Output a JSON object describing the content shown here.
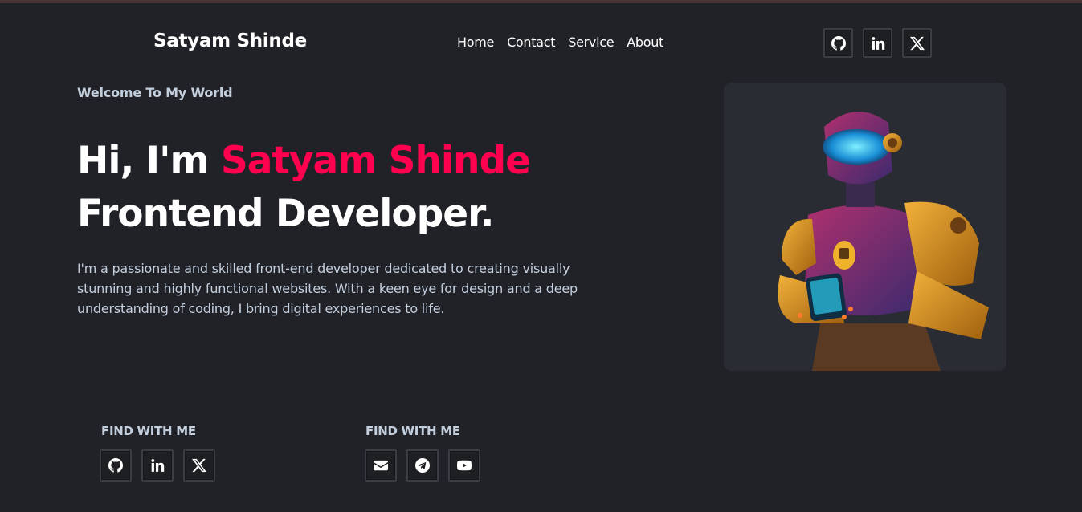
{
  "header": {
    "brand": "Satyam Shinde",
    "nav": [
      "Home",
      "Contact",
      "Service",
      "About"
    ]
  },
  "hero": {
    "welcome": "Welcome To My World",
    "greeting": "Hi, I'm ",
    "name": "Satyam Shinde",
    "role": "Frontend Developer.",
    "description": "I'm a passionate and skilled front-end developer dedicated to creating visually stunning and highly functional websites. With a keen eye for design and a deep understanding of coding, I bring digital experiences to life."
  },
  "social_left": {
    "heading": "FIND WITH ME",
    "icons": [
      "github-icon",
      "linkedin-icon",
      "x-icon"
    ]
  },
  "social_right": {
    "heading": "FIND WITH ME",
    "icons": [
      "email-icon",
      "telegram-icon",
      "youtube-icon"
    ]
  },
  "top_social": {
    "icons": [
      "github-icon",
      "linkedin-icon",
      "x-icon"
    ]
  },
  "colors": {
    "background": "#212227",
    "accent": "#ff014f",
    "text_muted": "#c4cfde",
    "card": "#2a2c34"
  }
}
